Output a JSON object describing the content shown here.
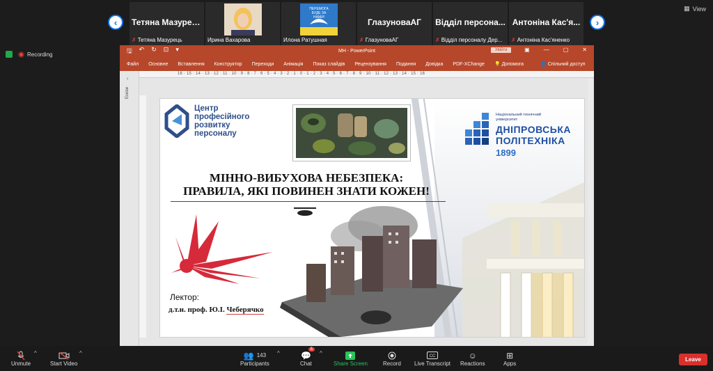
{
  "participants": [
    {
      "display": "Тетяна Мазурець",
      "caption": "Тетяна Мазурець",
      "muted": true
    },
    {
      "display": "",
      "caption": "Ирина Вахарова",
      "muted": false,
      "has_photo": true
    },
    {
      "display": "",
      "caption": "Илона Ратушная",
      "muted": false,
      "has_photo": true
    },
    {
      "display": "ГлазуноваАГ",
      "caption": "ГлазуноваАГ",
      "muted": true
    },
    {
      "display": "Відділ персона...",
      "caption": "Відділ персоналу Дер...",
      "muted": true
    },
    {
      "display": "Антоніна Кас'я...",
      "caption": "Антоніна Кас'яненко",
      "muted": true
    }
  ],
  "view_label": "View",
  "recording_label": "Recording",
  "ppt": {
    "doc_title": "МН  -  PowerPoint",
    "signin_label": "Увійти",
    "ribbon_tabs": [
      "Файл",
      "Основне",
      "Вставлення",
      "Конструктор",
      "Переходи",
      "Анімація",
      "Показ слайдів",
      "Рецензування",
      "Подання",
      "Довідка",
      "PDF-XChange"
    ],
    "help_label": "Допомога",
    "share_label": "Спільний доступ",
    "side_label": "Ескізи",
    "ruler_h": "16 · 15 · 14 · 13 · 12 · 11 · 10 · 9 · 8 · 7 · 6 · 5 · 4 · 3 · 2 · 1 · 0 · 1 · 2 · 3 · 4 · 5 · 6 · 7 · 8 · 9 · 10 · 11 · 12 · 13 · 14 · 15 · 16"
  },
  "slide": {
    "cpr_logo": [
      "Центр",
      "професійного",
      "розвитку",
      "персоналу"
    ],
    "uni_small": "Національний технічний університет",
    "uni_name1": "ДНІПРОВСЬКА",
    "uni_name2": "ПОЛІТЕХНІКА",
    "uni_year": "1899",
    "title_line1": "МІННО-ВИБУХОВА НЕБЕЗПЕКА:",
    "title_line2": "ПРАВИЛА, ЯКІ ПОВИНЕН ЗНАТИ КОЖЕН!",
    "lecturer_label": "Лектор:",
    "lecturer_name_prefix": "д.т.н. проф. Ю.І. ",
    "lecturer_surname": "Чеберячко",
    "colors": {
      "cpr_blue": "#2e4f8a",
      "uni_blue": "#1d4fa3",
      "explosion_red": "#d62a3a"
    }
  },
  "toolbar": {
    "unmute": "Unmute",
    "start_video": "Start Video",
    "participants": "Participants",
    "participants_count": "143",
    "chat": "Chat",
    "chat_badge": "5",
    "share_screen": "Share Screen",
    "record": "Record",
    "live_transcript": "Live Transcript",
    "reactions": "Reactions",
    "apps": "Apps",
    "leave": "Leave"
  }
}
